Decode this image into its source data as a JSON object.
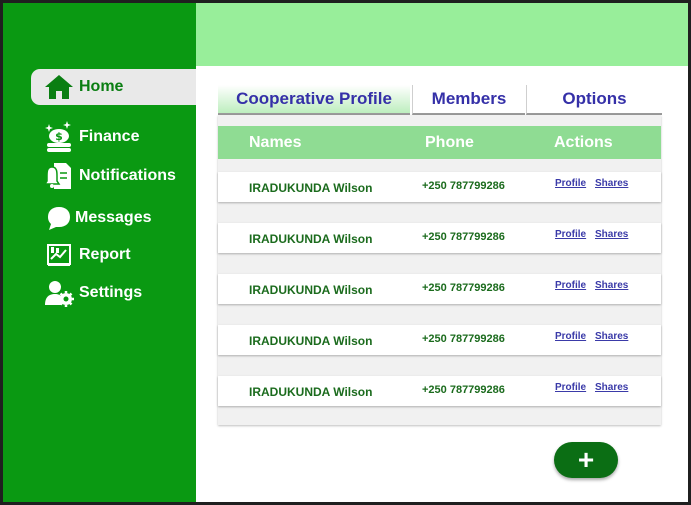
{
  "sidebar": {
    "items": [
      {
        "label": "Home",
        "icon": "home-icon"
      },
      {
        "label": "Finance",
        "icon": "finance-icon"
      },
      {
        "label": "Notifications",
        "icon": "notifications-icon"
      },
      {
        "label": "Messages",
        "icon": "messages-icon"
      },
      {
        "label": "Report",
        "icon": "report-icon"
      },
      {
        "label": "Settings",
        "icon": "settings-icon"
      }
    ]
  },
  "tabs": [
    {
      "label": "Cooperative Profile"
    },
    {
      "label": "Members"
    },
    {
      "label": "Options"
    }
  ],
  "table": {
    "headers": {
      "names": "Names",
      "phone": "Phone",
      "actions": "Actions"
    },
    "rows": [
      {
        "name": "IRADUKUNDA Wilson",
        "phone": "+250 787799286",
        "profile": "Profile",
        "shares": "Shares"
      },
      {
        "name": "IRADUKUNDA Wilson",
        "phone": "+250 787799286",
        "profile": "Profile",
        "shares": "Shares"
      },
      {
        "name": "IRADUKUNDA Wilson",
        "phone": "+250 787799286",
        "profile": "Profile",
        "shares": "Shares"
      },
      {
        "name": "IRADUKUNDA Wilson",
        "phone": "+250 787799286",
        "profile": "Profile",
        "shares": "Shares"
      },
      {
        "name": "IRADUKUNDA Wilson",
        "phone": "+250 787799286",
        "profile": "Profile",
        "shares": "Shares"
      }
    ]
  },
  "add_button": {
    "label": "+"
  },
  "colors": {
    "sidebar": "#0a9912",
    "topbar": "#98ee9a",
    "table_header": "#8fdc93",
    "tab_text": "#3530a8",
    "add_button": "#0b6e14"
  }
}
